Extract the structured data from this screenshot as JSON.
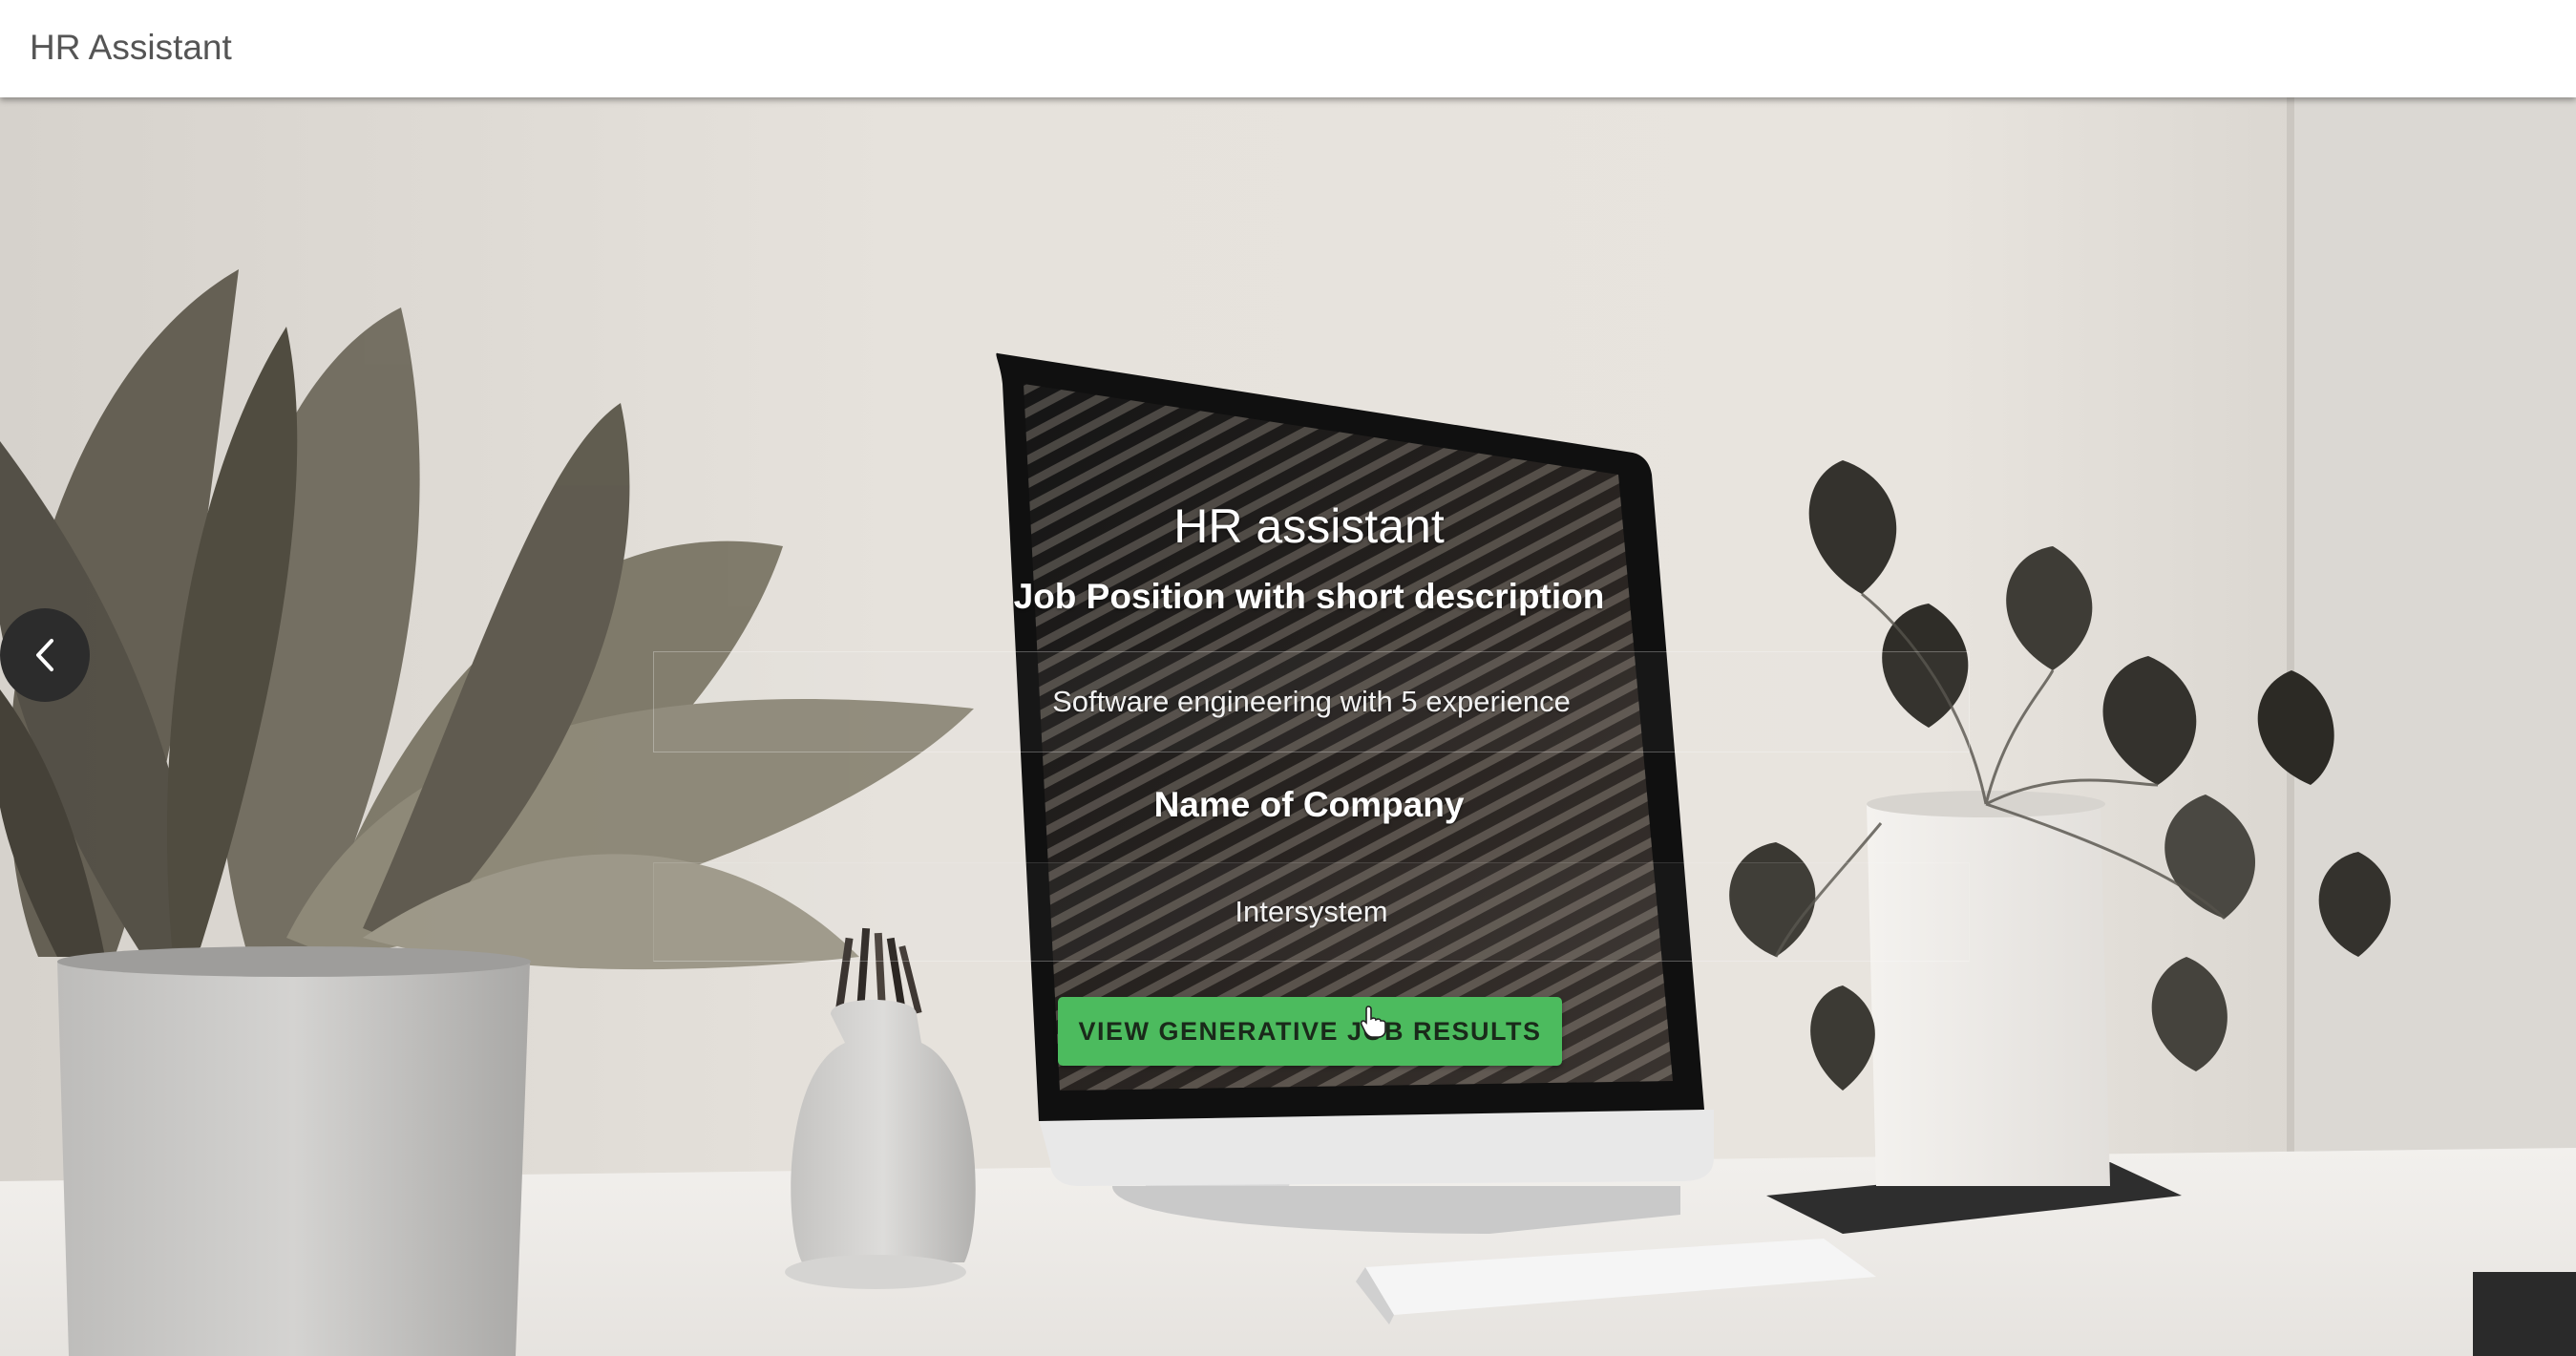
{
  "app": {
    "title": "HR Assistant"
  },
  "carousel": {
    "prev_icon": "chevron-left-icon"
  },
  "form": {
    "heading": "HR assistant",
    "job_label": "Job Position with short description",
    "job_value": "Software engineering with 5 experience",
    "company_label": "Name of Company",
    "company_value": "Intersystem",
    "submit_label": "VIEW GENERATIVE JOB RESULTS"
  },
  "colors": {
    "button_green": "#4cbb5e",
    "appbar_bg": "#ffffff",
    "title_text": "#555555"
  }
}
